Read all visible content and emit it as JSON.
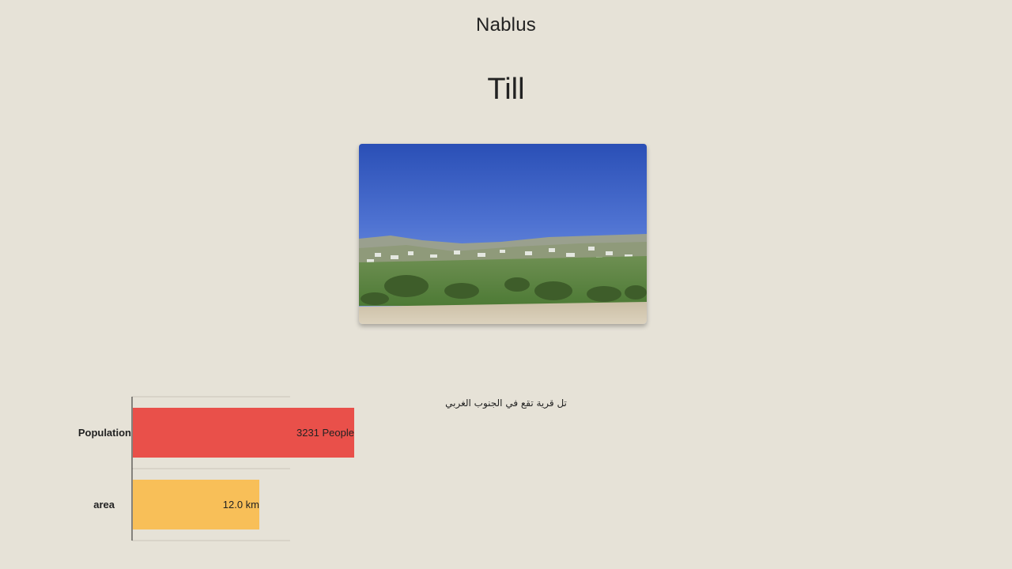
{
  "header": {
    "region": "Nablus",
    "place": "Till"
  },
  "photo": {
    "alt_icon": "landscape-photo"
  },
  "description": "تل قرية تقع في الجنوب الغربي",
  "chart_data": {
    "type": "bar",
    "orientation": "horizontal",
    "categories": [
      "Population",
      "area"
    ],
    "series": [
      {
        "values": [
          3231,
          12.0
        ]
      }
    ],
    "data_labels": [
      "3231 People",
      "12.0 km"
    ],
    "colors": [
      "#e9504a",
      "#f8bf58"
    ],
    "grid": true
  }
}
